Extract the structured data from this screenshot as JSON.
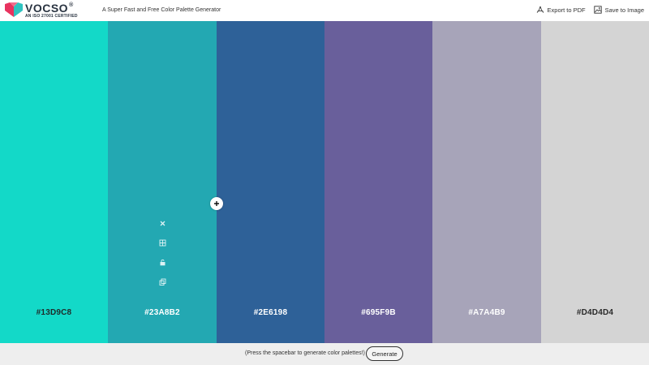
{
  "header": {
    "logo": {
      "wordmark": "VOCSO",
      "registered": "®",
      "subtitle": "AN ISO 27001 CERTIFIED"
    },
    "tagline": "A Super Fast and Free Color Palette Generator",
    "actions": [
      {
        "label": "Export to PDF",
        "icon": "pdf-icon"
      },
      {
        "label": "Save to Image",
        "icon": "image-icon"
      }
    ]
  },
  "palette": {
    "swatches": [
      {
        "hex": "#13D9C8",
        "color": "#13d9c8",
        "text_color": "#1f2a2a",
        "width": 133
      },
      {
        "hex": "#23A8B2",
        "color": "#23a8b2",
        "text_color": "#ffffff",
        "width": 134,
        "hovered": true
      },
      {
        "hex": "#2E6198",
        "color": "#2e6198",
        "text_color": "#ffffff",
        "width": 133
      },
      {
        "hex": "#695F9B",
        "color": "#695f9b",
        "text_color": "#ffffff",
        "width": 133
      },
      {
        "hex": "#A7A4B9",
        "color": "#a7a4b9",
        "text_color": "#ffffff",
        "width": 134
      },
      {
        "hex": "#D4D4D4",
        "color": "#d4d4d4",
        "text_color": "#2a2a2a",
        "width": 133
      }
    ],
    "tool_icons": [
      "close-icon",
      "grid-icon",
      "lock-icon",
      "copy-icon"
    ],
    "add_icon": "plus-icon"
  },
  "footer": {
    "hint": "(Press the spacebar to generate color palettes!)",
    "generate_label": "Generate"
  }
}
